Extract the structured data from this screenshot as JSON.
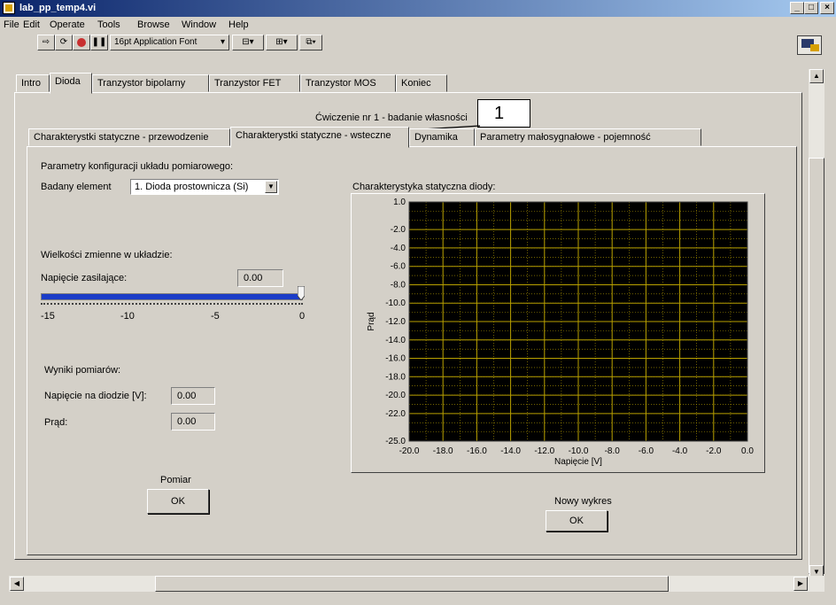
{
  "window": {
    "title": "lab_pp_temp4.vi",
    "buttons": [
      "_",
      "□",
      "×"
    ]
  },
  "menu": [
    "File",
    "Edit",
    "Operate",
    "Tools",
    "Browse",
    "Window",
    "Help"
  ],
  "toolbar": {
    "font_select": "16pt Application Font"
  },
  "tabs": [
    "Intro",
    "Dioda",
    "Tranzystor bipolarny",
    "Tranzystor FET",
    "Tranzystor MOS",
    "Koniec"
  ],
  "exercise_title": "Ćwiczenie nr 1 - badanie własności",
  "callout": "1",
  "subtabs": [
    "Charakterystki statyczne - przewodzenie",
    "Charakterystki statyczne - wsteczne",
    "Dynamika",
    "Parametry małosygnałowe - pojemność"
  ],
  "config": {
    "heading": "Parametry konfiguracji układu pomiarowego:",
    "element_label": "Badany element",
    "element_value": "1. Dioda prostownicza (Si)"
  },
  "variables": {
    "heading": "Wielkości zmienne w układzie:",
    "voltage_label": "Napięcie zasilające:",
    "voltage_value": "0.00",
    "slider_ticks": [
      "-15",
      "-10",
      "-5",
      "0"
    ],
    "slider_fraction": 1.0
  },
  "results": {
    "heading": "Wyniki pomiarów:",
    "diode_voltage_label": "Napięcie na diodzie [V]:",
    "diode_voltage_value": "0.00",
    "current_label": "Prąd:",
    "current_value": "0.00"
  },
  "measure": {
    "label": "Pomiar",
    "button": "OK"
  },
  "new_chart": {
    "label": "Nowy wykres",
    "button": "OK"
  },
  "chart_data": {
    "type": "line",
    "title": "Charakterystyka statyczna diody:",
    "xlabel": "Napięcie [V]",
    "ylabel": "Prąd",
    "xlim": [
      -20.0,
      0.0
    ],
    "ylim": [
      -25.0,
      1.0
    ],
    "x_ticks": [
      "-20.0",
      "-18.0",
      "-16.0",
      "-14.0",
      "-12.0",
      "-10.0",
      "-8.0",
      "-6.0",
      "-4.0",
      "-2.0",
      "0.0"
    ],
    "y_ticks": [
      "1.0",
      "-2.0",
      "-4.0",
      "-6.0",
      "-8.0",
      "-10.0",
      "-12.0",
      "-14.0",
      "-16.0",
      "-18.0",
      "-20.0",
      "-22.0",
      "-25.0"
    ],
    "series": [],
    "grid": true,
    "plot_background": "#000000",
    "grid_color": "#b8a000"
  }
}
